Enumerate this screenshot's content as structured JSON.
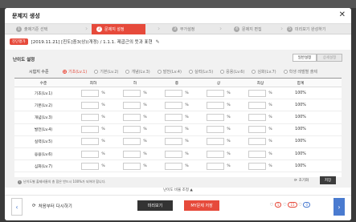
{
  "dialog": {
    "title": "문제지 생성",
    "close_label": "✕"
  },
  "steps": [
    {
      "num": "1",
      "label": "출제기준 선택"
    },
    {
      "num": "2",
      "label": "문제지 설정"
    },
    {
      "num": "3",
      "label": "부가설정"
    },
    {
      "num": "4",
      "label": "문제지 편집"
    },
    {
      "num": "5",
      "label": "미리보기 완성하기"
    }
  ],
  "info": {
    "badge": "진단평가",
    "title": "[2019.11.21] [진도]중3(상)(개정) / 1.1.1. 제곱근의 뜻과 표현"
  },
  "panel": {
    "title": "난이도 설정",
    "toggle_on": "일반설정",
    "toggle_off": "상세설정",
    "level_label": "시험지 수준",
    "levels": [
      {
        "label": "기초(Lv.1)",
        "selected": true
      },
      {
        "label": "기본(Lv.2)",
        "selected": false
      },
      {
        "label": "개념(Lv.3)",
        "selected": false
      },
      {
        "label": "발전(Lv.4)",
        "selected": false
      },
      {
        "label": "실력(Lv.5)",
        "selected": false
      },
      {
        "label": "응용(Lv.6)",
        "selected": false
      },
      {
        "label": "심화(Lv.7)",
        "selected": false
      },
      {
        "label": "학생 레벨별 출제",
        "selected": false
      }
    ]
  },
  "grid": {
    "headers": [
      "수준",
      "최하",
      "하",
      "중",
      "상",
      "최상",
      "합계"
    ],
    "percent_sign": "%",
    "rows": [
      {
        "label": "기초(Lv.1)",
        "total": "100%"
      },
      {
        "label": "기본(Lv.2)",
        "total": "100%"
      },
      {
        "label": "개념(Lv.3)",
        "total": "100%"
      },
      {
        "label": "발전(Lv.4)",
        "total": "100%"
      },
      {
        "label": "실력(Lv.5)",
        "total": "100%"
      },
      {
        "label": "응용(Lv.6)",
        "total": "100%"
      },
      {
        "label": "심화(Lv.7)",
        "total": "100%"
      }
    ]
  },
  "note": "난이도별 출제비율의 총 합은 반드시 100%가 되어야 합니다.",
  "reset_label": "초기화",
  "save_label": "저장",
  "collapse_label": "난이도 비율 조정 ▲",
  "footer": {
    "restart_label": "처음부터 다시하기",
    "preview_label": "미리보기",
    "mysave_label": "MY문제 저장",
    "count1": "5",
    "count2": "15",
    "count3": "0"
  },
  "colors": {
    "accent": "#e64a3b",
    "blue": "#4a7bd0"
  }
}
